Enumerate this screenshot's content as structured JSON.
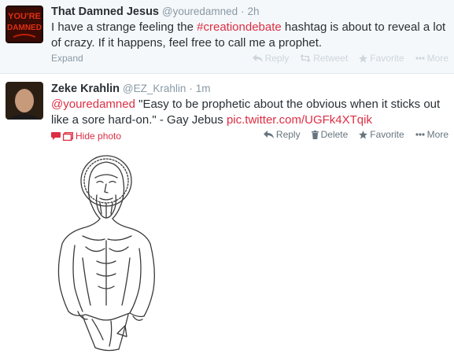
{
  "tweets": [
    {
      "fullname": "That Damned Jesus",
      "username": "@youredamned",
      "timestamp": "2h",
      "avatar_text": "YOU'RE DAMNED",
      "text_before": "I have a strange feeling the ",
      "hashtag": "#creationdebate",
      "text_after": " hashtag is about to reveal a lot of crazy. If it happens, feel free to call me a prophet.",
      "expand_label": "Expand",
      "actions": {
        "reply": "Reply",
        "retweet": "Retweet",
        "favorite": "Favorite",
        "more": "More"
      }
    },
    {
      "fullname": "Zeke Krahlin",
      "username": "@EZ_Krahlin",
      "timestamp": "1m",
      "mention": "@youredamned",
      "text_middle": " \"Easy to be prophetic about the obvious when it sticks out like a sore hard-on.\" - Gay Jebus ",
      "link": "pic.twitter.com/UGFk4XTqik",
      "hide_photo_label": "Hide photo",
      "actions": {
        "reply": "Reply",
        "delete": "Delete",
        "favorite": "Favorite",
        "more": "More"
      }
    }
  ],
  "colors": {
    "accent": "#dd2e44",
    "muted": "#8899a6",
    "selected_bg": "#f5f8fa"
  },
  "icons": [
    "reply-icon",
    "retweet-icon",
    "star-icon",
    "trash-icon",
    "dots-icon",
    "comment-icon",
    "photo-icon"
  ]
}
